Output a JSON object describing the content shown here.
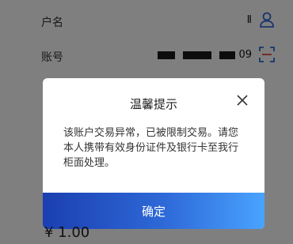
{
  "form": {
    "username_label": "户名",
    "username_masked_char": "Ⅱ",
    "account_label": "账号",
    "account_tail": "09"
  },
  "amount": "¥ 1.00",
  "dialog": {
    "title": "温馨提示",
    "message": "该账户交易异常，已被限制交易。请您本人携带有效身份证件及银行卡至我行柜面处理。",
    "confirm_label": "确定"
  },
  "icons": {
    "user": "user-icon",
    "scan": "scan-icon",
    "close": "close-icon"
  },
  "colors": {
    "accent": "#2e69d8",
    "button_gradient_start": "#1b3fb0",
    "button_gradient_end": "#49a3ff",
    "overlay": "#000000"
  }
}
